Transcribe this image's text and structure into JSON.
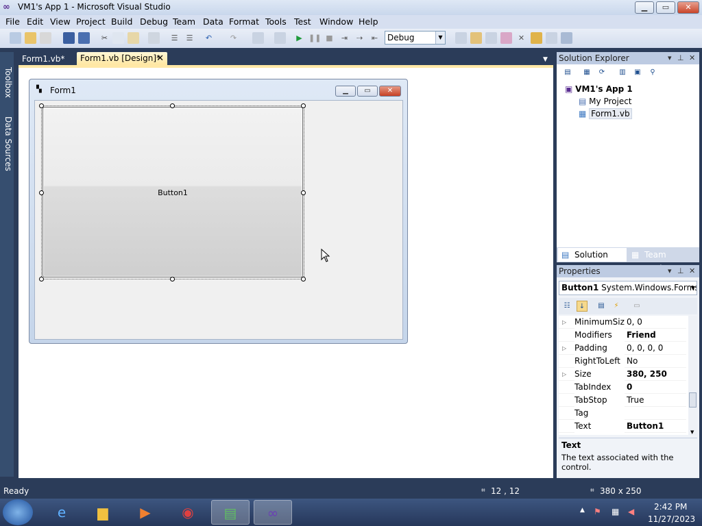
{
  "window": {
    "title": "VM1's App 1 - Microsoft Visual Studio",
    "min": "▁",
    "max": "▭",
    "close": "✕"
  },
  "menu": [
    "File",
    "Edit",
    "View",
    "Project",
    "Build",
    "Debug",
    "Team",
    "Data",
    "Format",
    "Tools",
    "Test",
    "Window",
    "Help"
  ],
  "toolbar": {
    "config": "Debug"
  },
  "leftdock": {
    "toolbox": "Toolbox",
    "datasources": "Data Sources"
  },
  "tabs": {
    "code": "Form1.vb*",
    "design": "Form1.vb [Design]*",
    "close": "✕"
  },
  "form": {
    "title": "Form1",
    "button_text": "Button1"
  },
  "solution_explorer": {
    "title": "Solution Explorer",
    "items": [
      "VM1's App 1",
      "My Project",
      "Form1.vb"
    ],
    "tab1": "Solution Ex...",
    "tab2": "Team Explo..."
  },
  "properties": {
    "title": "Properties",
    "object_name": "Button1",
    "object_type": "System.Windows.Forms.E",
    "rows": [
      {
        "name": "MinimumSize",
        "value": "0, 0",
        "bold": false,
        "expand": true
      },
      {
        "name": "Modifiers",
        "value": "Friend",
        "bold": true,
        "expand": false
      },
      {
        "name": "Padding",
        "value": "0, 0, 0, 0",
        "bold": false,
        "expand": true
      },
      {
        "name": "RightToLeft",
        "value": "No",
        "bold": false,
        "expand": false
      },
      {
        "name": "Size",
        "value": "380, 250",
        "bold": true,
        "expand": true
      },
      {
        "name": "TabIndex",
        "value": "0",
        "bold": true,
        "expand": false
      },
      {
        "name": "TabStop",
        "value": "True",
        "bold": false,
        "expand": false
      },
      {
        "name": "Tag",
        "value": "",
        "bold": false,
        "expand": false
      },
      {
        "name": "Text",
        "value": "Button1",
        "bold": true,
        "expand": false
      }
    ],
    "desc_title": "Text",
    "desc_text": "The text associated with the control."
  },
  "status": {
    "text": "Ready",
    "position": "12 , 12",
    "size": "380 x 250"
  },
  "taskbar": {
    "time": "2:42 PM",
    "date": "11/27/2023"
  }
}
